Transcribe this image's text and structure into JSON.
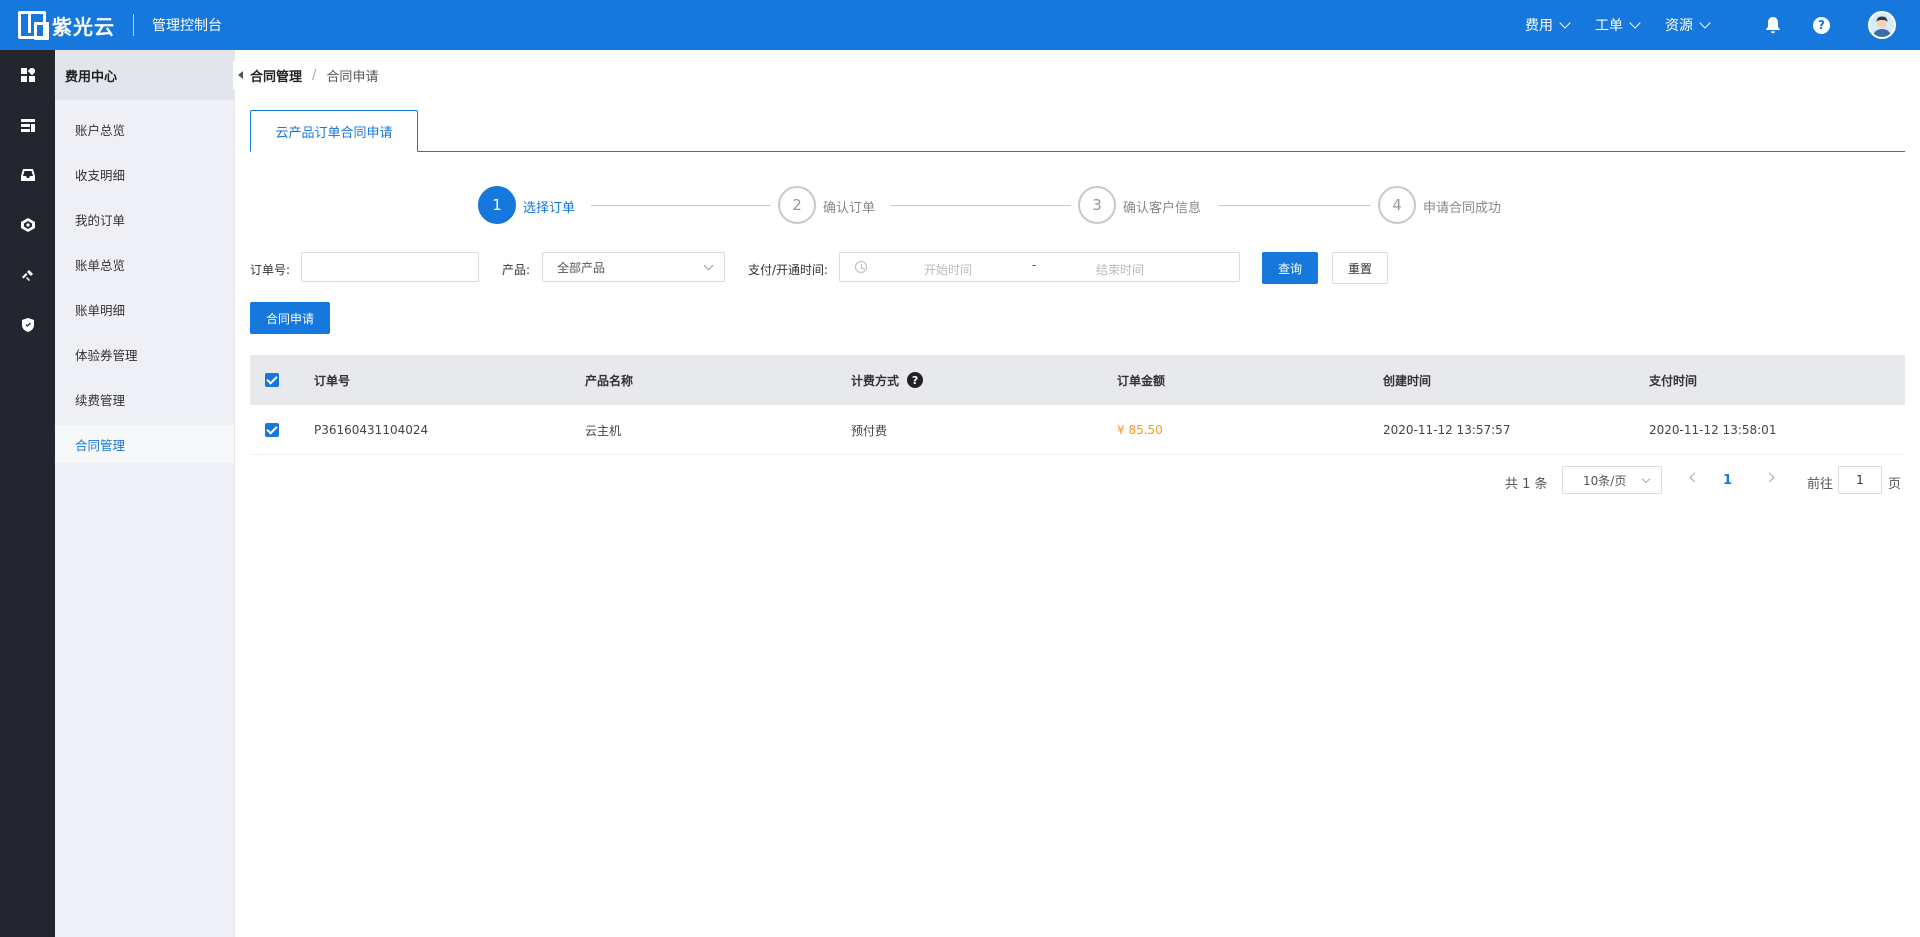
{
  "header": {
    "brand": "紫光云",
    "console_title": "管理控制台",
    "menus": [
      {
        "label": "费用"
      },
      {
        "label": "工单"
      },
      {
        "label": "资源"
      }
    ],
    "help_glyph": "?"
  },
  "rail": {
    "icons": [
      "dashboard-icon",
      "storage-icon",
      "inbox-icon",
      "network-icon",
      "tools-icon",
      "shield-icon"
    ]
  },
  "sidebar": {
    "title": "费用中心",
    "items": [
      {
        "label": "账户总览"
      },
      {
        "label": "收支明细"
      },
      {
        "label": "我的订单"
      },
      {
        "label": "账单总览"
      },
      {
        "label": "账单明细"
      },
      {
        "label": "体验券管理"
      },
      {
        "label": "续费管理"
      },
      {
        "label": "合同管理",
        "active": true
      }
    ]
  },
  "breadcrumb": {
    "parent": "合同管理",
    "separator": "/",
    "current": "合同申请"
  },
  "tabs": [
    {
      "label": "云产品订单合同申请",
      "active": true
    }
  ],
  "steps": [
    {
      "num": "1",
      "label": "选择订单",
      "active": true
    },
    {
      "num": "2",
      "label": "确认订单",
      "active": false
    },
    {
      "num": "3",
      "label": "确认客户信息",
      "active": false
    },
    {
      "num": "4",
      "label": "申请合同成功",
      "active": false
    }
  ],
  "filters": {
    "order_label": "订单号:",
    "order_value": "",
    "product_label": "产品:",
    "product_value": "全部产品",
    "time_label": "支付/开通时间:",
    "start_placeholder": "开始时间",
    "range_sep": "-",
    "end_placeholder": "结束时间",
    "query_label": "查询",
    "reset_label": "重置"
  },
  "apply_button": "合同申请",
  "table": {
    "columns": [
      "订单号",
      "产品名称",
      "计费方式",
      "订单金额",
      "创建时间",
      "支付时间"
    ],
    "billing_help": "?",
    "rows": [
      {
        "order_no": "P36160431104024",
        "product": "云主机",
        "billing": "预付费",
        "amount": "¥ 85.50",
        "created": "2020-11-12 13:57:57",
        "paid": "2020-11-12 13:58:01",
        "checked": true
      }
    ]
  },
  "pagination": {
    "total": "共 1 条",
    "page_size": "10条/页",
    "current_page": "1",
    "goto_label": "前往",
    "goto_value": "1",
    "page_suffix": "页"
  },
  "colors": {
    "primary": "#1677dd",
    "amount": "#f59a23",
    "rail": "#23262e"
  }
}
